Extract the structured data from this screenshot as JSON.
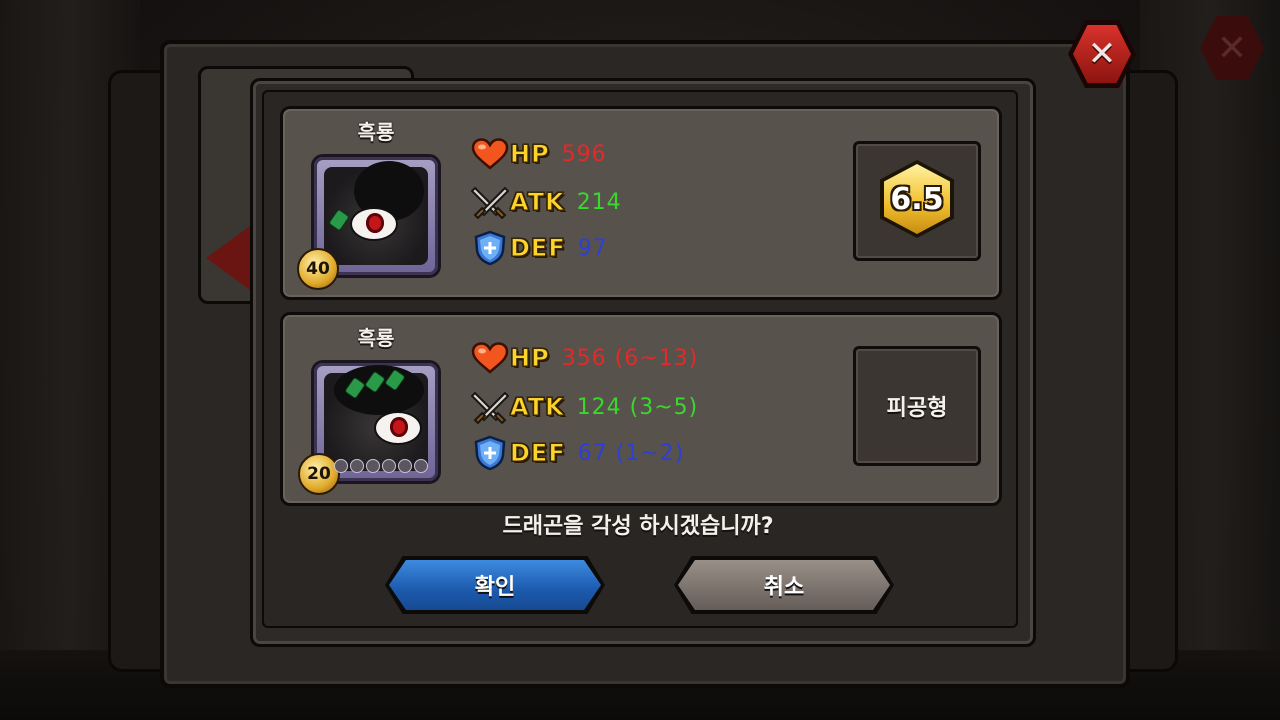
{
  "dialog": {
    "question": "드래곤을 각성 하시겠습니까?",
    "confirm_label": "확인",
    "cancel_label": "취소"
  },
  "dragons": [
    {
      "name": "흑룡",
      "level": "40",
      "stats": {
        "hp_label": "HP",
        "hp_value": "596",
        "atk_label": "ATK",
        "atk_value": "214",
        "def_label": "DEF",
        "def_value": "97"
      },
      "grade": "6.5"
    },
    {
      "name": "흑룡",
      "level": "20",
      "stars_filled": 0,
      "stars_total": 6,
      "stats": {
        "hp_label": "HP",
        "hp_value": "356 (6~13)",
        "atk_label": "ATK",
        "atk_value": "124 (3~5)",
        "def_label": "DEF",
        "def_value": "67 (1~2)"
      },
      "type": "피공형"
    }
  ],
  "icons": {
    "close": "close-icon",
    "hp": "heart-icon",
    "atk": "crossed-swords-icon",
    "def": "shield-icon"
  },
  "colors": {
    "hp": "#e42929",
    "atk": "#39d82c",
    "def": "#2e3fd6",
    "label": "#ffd42a",
    "confirm": "#1c5aae",
    "cancel": "#7a716c",
    "close": "#c62520"
  }
}
